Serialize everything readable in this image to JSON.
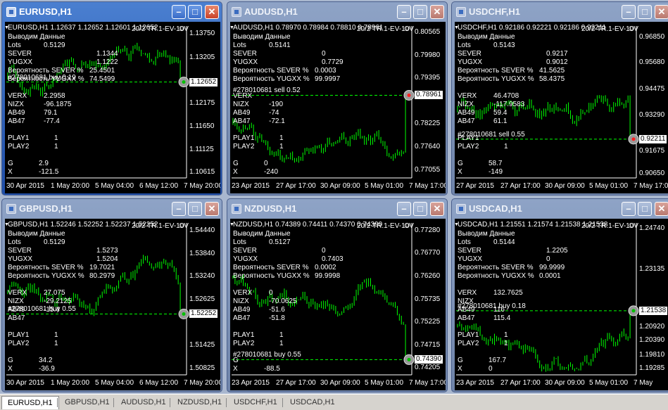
{
  "colors": {
    "chart_bg": "#000000",
    "candle": "#00ff00",
    "text": "#ffffff",
    "active_titlebar": "#2a5fbf",
    "inactive_titlebar": "#7f94b8"
  },
  "windows": [
    {
      "title": "EURUSD,H1",
      "active": true,
      "header": "EURUSD,H1  1.12637 1.12652 1.12601 1.12652",
      "indicator": "20/2 TR.1-EV-10V",
      "price_labels": [
        "1.13750",
        "1.13205",
        "1.12652",
        "1.12175",
        "1.11650",
        "1.11125",
        "1.10615"
      ],
      "price_levels": [
        1.1375,
        1.13205,
        1.12652,
        1.12175,
        1.1165,
        1.11125,
        1.10615
      ],
      "ylim": [
        1.1048,
        1.1392
      ],
      "current": "1.12652",
      "current_value": 1.12652,
      "time_labels": [
        "30 Apr 2015",
        "1 May 20:00",
        "5 May 04:00",
        "6 May 12:00",
        "7 May 20:00"
      ],
      "stats": {
        "vivodim": "Выводим Данные",
        "lots_label": "Lots",
        "lots": "0.5129",
        "sever_label": "SEVER",
        "sever": "1.1344",
        "yugxx_label": "YUGXX",
        "yugxx": "1.1222",
        "prob_sever_label": "Вероятность SEVER %",
        "prob_sever": "25.4501",
        "prob_yugxx_label": "Вероятность YUGXX %",
        "prob_yugxx": "74.5499",
        "verx_label": "VERX",
        "verx": "2.2958",
        "nizx_label": "NIZX",
        "nizx": "-96.1875",
        "ab49_label": "AB49",
        "ab49": "79.1",
        "ab47_label": "AB47",
        "ab47": "-77.4",
        "play1_label": "PLAY1",
        "play1": "1",
        "play2_label": "PLAY2",
        "play2": "1",
        "g_label": "G",
        "g": "2.9",
        "x_label": "X",
        "x": "-121.5"
      },
      "order": "#278010681 buy 0.19",
      "order_type": "buy"
    },
    {
      "title": "AUDUSD,H1",
      "active": false,
      "header": "AUDUSD,H1  0.78970 0.78984 0.78810 0.78961",
      "indicator": "20/2 TR.1-EV-10V",
      "price_labels": [
        "0.80565",
        "0.79980",
        "0.79395",
        "0.78961",
        "0.78225",
        "0.77640",
        "0.77055"
      ],
      "price_levels": [
        0.80565,
        0.7998,
        0.79395,
        0.78961,
        0.78225,
        0.7764,
        0.77055
      ],
      "ylim": [
        0.7685,
        0.8073
      ],
      "current": "0.78961",
      "current_value": 0.78961,
      "time_labels": [
        "23 Apr 2015",
        "27 Apr 17:00",
        "30 Apr 09:00",
        "5 May 01:00",
        "7 May 17:00"
      ],
      "stats": {
        "vivodim": "Выводим Данные",
        "lots_label": "Lots",
        "lots": "0.5141",
        "sever_label": "SEVER",
        "sever": "0",
        "yugxx_label": "YUGXX",
        "yugxx": "0.7729",
        "prob_sever_label": "Вероятность SEVER %",
        "prob_sever": "0.0003",
        "prob_yugxx_label": "Вероятность YUGXX %",
        "prob_yugxx": "99.9997",
        "verx_label": "VERX",
        "verx": "",
        "nizx_label": "NIZX",
        "nizx": "-190",
        "ab49_label": "AB49",
        "ab49": "-74",
        "ab47_label": "AB47",
        "ab47": "-72.1",
        "play1_label": "PLAY1",
        "play1": "1",
        "play2_label": "PLAY2",
        "play2": "1",
        "g_label": "G",
        "g": "0",
        "x_label": "X",
        "x": "-240"
      },
      "order": "#278010681 sell 0.52",
      "order_type": "sell"
    },
    {
      "title": "USDCHF,H1",
      "active": false,
      "header": "USDCHF,H1  0.92186 0.92221 0.92186 0.92211",
      "indicator": "20/2 TR.1-EV-10V",
      "price_labels": [
        "0.96850",
        "0.95680",
        "0.94475",
        "0.93290",
        "0.92211",
        "0.91675",
        "0.90650"
      ],
      "price_levels": [
        0.9685,
        0.9568,
        0.94475,
        0.9329,
        0.92211,
        0.91675,
        0.9065
      ],
      "ylim": [
        0.9045,
        0.9735
      ],
      "current": "0.92211",
      "current_value": 0.92211,
      "time_labels": [
        "27 Apr 2015",
        "27 Apr 17:00",
        "30 Apr 09:00",
        "5 May 01:00",
        "7 May 17:00"
      ],
      "stats": {
        "vivodim": "Выводим Данные",
        "lots_label": "Lots",
        "lots": "0.5143",
        "sever_label": "SEVER",
        "sever": "0.9217",
        "yugxx_label": "YUGXX",
        "yugxx": "0.9012",
        "prob_sever_label": "Вероятность SEVER %",
        "prob_sever": "41.5625",
        "prob_yugxx_label": "Вероятность YUGXX %",
        "prob_yugxx": "58.4375",
        "verx_label": "VERX",
        "verx": "46.4708",
        "nizx_label": "NIZX",
        "nizx": "-117.9583",
        "ab49_label": "AB49",
        "ab49": "59.4",
        "ab47_label": "AB47",
        "ab47": "61.1",
        "play1_label": "PLAY1",
        "play1": "",
        "play2_label": "PLAY2",
        "play2": "1",
        "g_label": "G",
        "g": "58.7",
        "x_label": "X",
        "x": "-149"
      },
      "order": "#278010681 sell 0.55",
      "order_type": "sell"
    },
    {
      "title": "GBPUSD,H1",
      "active": false,
      "header": "GBPUSD,H1  1.52246 1.52252 1.52237 1.52252",
      "indicator": "20/2 TR.1-EV-10V",
      "price_labels": [
        "1.54440",
        "1.53840",
        "1.53240",
        "1.52625",
        "1.52252",
        "1.51425",
        "1.50825"
      ],
      "price_levels": [
        1.5444,
        1.5384,
        1.5324,
        1.52625,
        1.52252,
        1.51425,
        1.50825
      ],
      "ylim": [
        1.5065,
        1.5465
      ],
      "current": "1.52252",
      "current_value": 1.52252,
      "time_labels": [
        "30 Apr 2015",
        "1 May 20:00",
        "5 May 04:00",
        "6 May 12:00",
        "7 May 20:00"
      ],
      "stats": {
        "vivodim": "Выводим Данные",
        "lots_label": "Lots",
        "lots": "0.5129",
        "sever_label": "SEVER",
        "sever": "1.5273",
        "yugxx_label": "YUGXX",
        "yugxx": "1.5204",
        "prob_sever_label": "Вероятность SEVER %",
        "prob_sever": "19.7021",
        "prob_yugxx_label": "Вероятность YUGXX %",
        "prob_yugxx": "80.2979",
        "verx_label": "VERX",
        "verx": "27.075",
        "nizx_label": "NIZX",
        "nizx": "-29.2125",
        "ab49_label": "AB49",
        "ab49": "-15.4",
        "ab47_label": "AB47",
        "ab47": "",
        "play1_label": "PLAY1",
        "play1": "1",
        "play2_label": "PLAY2",
        "play2": "1",
        "g_label": "G",
        "g": "34.2",
        "x_label": "X",
        "x": "-36.9"
      },
      "order": "#278010681 buy 0.55",
      "order_type": "buy"
    },
    {
      "title": "NZDUSD,H1",
      "active": false,
      "header": "NZDUSD,H1  0.74389 0.74411 0.74370 0.74390",
      "indicator": "20/2 TR.1-EV-10V",
      "price_labels": [
        "0.77280",
        "0.76770",
        "0.76260",
        "0.75735",
        "0.75225",
        "0.74715",
        "0.74390",
        "0.74205"
      ],
      "price_levels": [
        0.7728,
        0.7677,
        0.7626,
        0.75735,
        0.75225,
        0.74715,
        0.7439,
        0.74205
      ],
      "ylim": [
        0.7405,
        0.7745
      ],
      "current": "0.74390",
      "current_value": 0.7439,
      "time_labels": [
        "23 Apr 2015",
        "27 Apr 17:00",
        "30 Apr 09:00",
        "5 May 01:00",
        "7 May 17:00"
      ],
      "stats": {
        "vivodim": "Выводим Данные",
        "lots_label": "Lots",
        "lots": "0.5127",
        "sever_label": "SEVER",
        "sever": "0",
        "yugxx_label": "YUGXX",
        "yugxx": "0.7403",
        "prob_sever_label": "Вероятность SEVER %",
        "prob_sever": "0.0002",
        "prob_yugxx_label": "Вероятность YUGXX %",
        "prob_yugxx": "99.9998",
        "verx_label": "VERX",
        "verx": "0",
        "nizx_label": "NIZX",
        "nizx": "-70.0625",
        "ab49_label": "AB49",
        "ab49": "-51.6",
        "ab47_label": "AB47",
        "ab47": "-51.8",
        "play1_label": "PLAY1",
        "play1": "1",
        "play2_label": "PLAY2",
        "play2": "1",
        "g_label": "G",
        "g": "",
        "x_label": "X",
        "x": "-88.5"
      },
      "order": "#278010681 buy 0.55",
      "order_type": "buy"
    },
    {
      "title": "USDCAD,H1",
      "active": false,
      "header": "USDCAD,H1  1.21551 1.21574 1.21538 1.21538",
      "indicator": "20/2 TR.1-EV-10V",
      "price_labels": [
        "1.24740",
        "1.23135",
        "1.21538",
        "1.20920",
        "1.20390",
        "1.19810",
        "1.19285"
      ],
      "price_levels": [
        1.2474,
        1.23135,
        1.21538,
        1.2092,
        1.2039,
        1.1981,
        1.19285
      ],
      "ylim": [
        1.1905,
        1.2495
      ],
      "current": "1.21538",
      "current_value": 1.21538,
      "time_labels": [
        "23 Apr 2015",
        "27 Apr 17:00",
        "30 Apr 09:00",
        "5 May 01:00",
        "7 May"
      ],
      "stats": {
        "vivodim": "Выводим Данные",
        "lots_label": "Lots",
        "lots": "0.5144",
        "sever_label": "SEVER",
        "sever": "1.2205",
        "yugxx_label": "YUGXX",
        "yugxx": "0",
        "prob_sever_label": "Вероятность SEVER %",
        "prob_sever": "99.9999",
        "prob_yugxx_label": "Вероятность YUGXX %",
        "prob_yugxx": "0.0001",
        "verx_label": "VERX",
        "verx": "132.7625",
        "nizx_label": "NIZX",
        "nizx": "",
        "ab49_label": "AB49",
        "ab49": "116",
        "ab47_label": "AB47",
        "ab47": "115.4",
        "play1_label": "PLAY1",
        "play1": "1",
        "play2_label": "PLAY2",
        "play2": "1",
        "g_label": "G",
        "g": "167.7",
        "x_label": "X",
        "x": "0"
      },
      "order": "#278010681 buy 0.18",
      "order_type": "buy"
    }
  ],
  "taskbar": {
    "tabs": [
      "EURUSD,H1",
      "GBPUSD,H1",
      "AUDUSD,H1",
      "NZDUSD,H1",
      "USDCHF,H1",
      "USDCAD,H1"
    ],
    "selected": 0
  },
  "icons": {
    "minimize": "minimize-icon",
    "maximize": "maximize-icon",
    "close": "close-icon",
    "smiley": "smiley-icon",
    "menu": "menu-arrow-icon"
  }
}
